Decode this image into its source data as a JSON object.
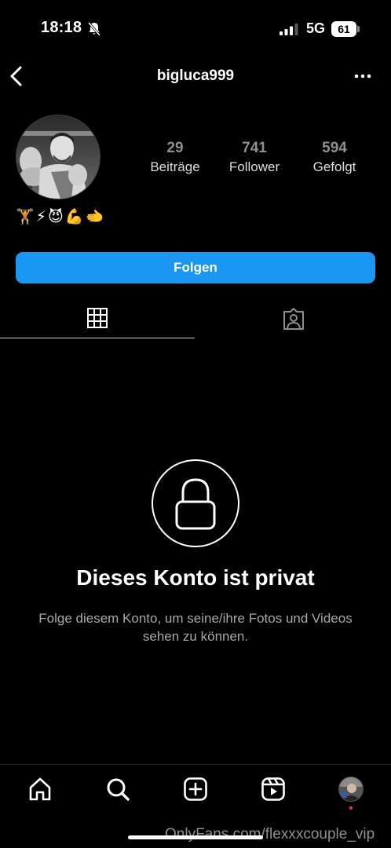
{
  "status_bar": {
    "time": "18:18",
    "network": "5G",
    "battery": "61",
    "icons": [
      "bell-muted-icon",
      "signal-icon",
      "battery-icon"
    ]
  },
  "header": {
    "username": "bigluca999",
    "icons": [
      "back-chevron-icon",
      "more-dots-icon"
    ]
  },
  "profile": {
    "stats": [
      {
        "value": "29",
        "label": "Beiträge"
      },
      {
        "value": "741",
        "label": "Follower"
      },
      {
        "value": "594",
        "label": "Gefolgt"
      }
    ],
    "bio": "🏋️⚡😈💪🫲"
  },
  "follow_button": {
    "label": "Folgen"
  },
  "tabs": {
    "icons": [
      "grid-icon",
      "tagged-icon"
    ]
  },
  "private": {
    "title": "Dieses Konto ist privat",
    "text": "Folge diesem Konto, um seine/ihre Fotos und Videos sehen zu können."
  },
  "bottom_nav": {
    "icons": [
      "home-icon",
      "search-icon",
      "create-icon",
      "reels-icon",
      "profile-avatar-icon"
    ]
  },
  "watermark": "OnlyFans.com/flexxxcouple_vip",
  "colors": {
    "background": "#000000",
    "accent": "#1a97f3",
    "muted_text": "#a8a8a8",
    "notification_dot": "#ff3040"
  }
}
